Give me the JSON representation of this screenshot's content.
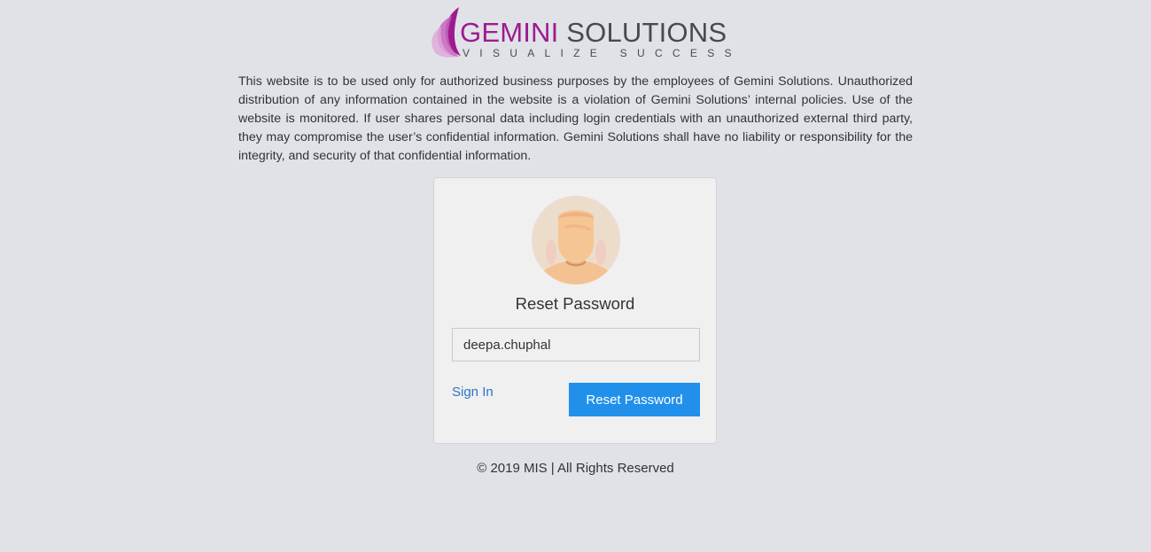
{
  "logo": {
    "brand_primary": "GEMINI",
    "brand_secondary": "SOLUTIONS",
    "tagline": "VISUALIZE SUCCESS"
  },
  "disclaimer": "This website is to be used only for authorized business purposes by the employees of Gemini Solutions. Unauthorized distribution of any information contained in the website is a violation of Gemini Solutions’ internal policies. Use of the website is monitored. If user shares personal data including login credentials with an unauthorized external third party, they may compromise the user’s confidential information. Gemini Solutions shall have no liability or responsibility for the integrity, and security of that confidential information.",
  "card": {
    "avatar_icon": "user-avatar",
    "title": "Reset Password",
    "username_value": "deepa.chuphal",
    "signin_label": "Sign In",
    "reset_button_label": "Reset Password"
  },
  "footer": "© 2019 MIS | All Rights Reserved",
  "colors": {
    "brand": "#9c1c90",
    "primary_button": "#2190ea",
    "link": "#2a74c5",
    "background": "#e1e2e7"
  }
}
